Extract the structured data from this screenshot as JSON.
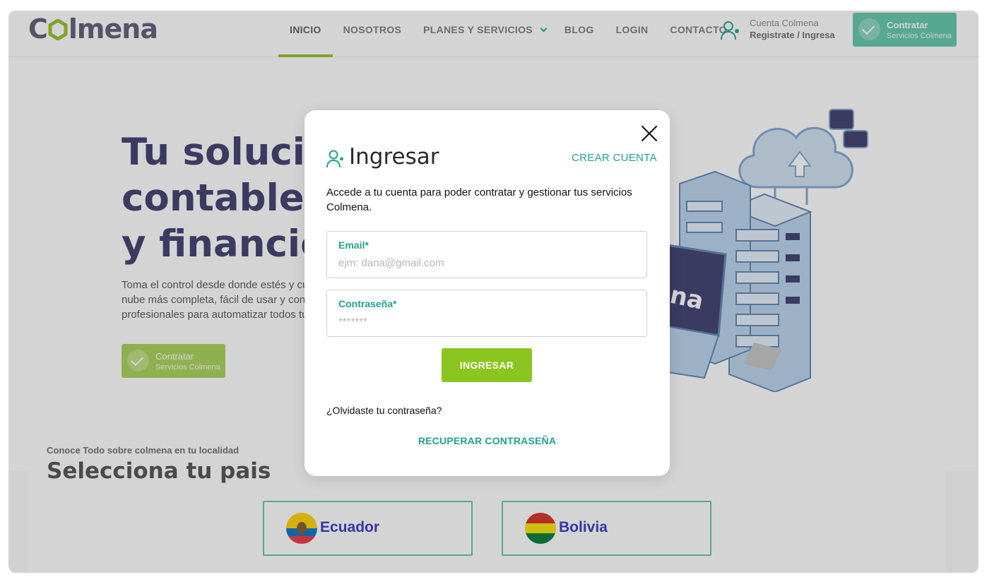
{
  "header": {
    "logo": {
      "pre": "C",
      "post": "lmena"
    },
    "nav": [
      {
        "label": "INICIO",
        "active": true
      },
      {
        "label": "NOSOTROS"
      },
      {
        "label": "PLANES Y SERVICIOS",
        "dropdown": true
      },
      {
        "label": "BLOG"
      },
      {
        "label": "LOGIN"
      },
      {
        "label": "CONTACTO"
      }
    ],
    "account": {
      "line1": "Cuenta Colmena",
      "line2": "Registrate / Ingresa",
      "icon": "user-icon"
    },
    "cta": {
      "line1": "Contratar",
      "line2": "Servicios Colmena",
      "icon": "check-circle-icon"
    }
  },
  "hero": {
    "title_lines": [
      "Tu solución",
      "contable, c",
      "y financier"
    ],
    "desc_lines": [
      "Toma el control desde donde estés y cu",
      "nube más completa, fácil de usar y con",
      "profesionales para automatizar todos tu"
    ],
    "cta": {
      "line1": "Contratar",
      "line2": "Servicios Colmena"
    },
    "illustration_text": "na"
  },
  "countries": {
    "kicker": "Conoce Todo sobre colmena en tu localidad",
    "heading": "Selecciona tu pais",
    "items": [
      {
        "name": "Ecuador",
        "flag": "ecuador-flag-icon"
      },
      {
        "name": "Bolivia",
        "flag": "bolivia-flag-icon"
      }
    ]
  },
  "modal": {
    "title": "Ingresar",
    "create_account": "CREAR CUENTA",
    "description": "Accede a tu cuenta para poder contratar y gestionar tus servicios Colmena.",
    "email": {
      "label": "Email*",
      "placeholder": "ejm: dana@gmail.com",
      "value": ""
    },
    "password": {
      "label": "Contraseña*",
      "placeholder": "*******",
      "value": ""
    },
    "submit": "INGRESAR",
    "forgot": "¿Olvidaste tu contraseña?",
    "recover": "RECUPERAR CONTRASEÑA"
  },
  "colors": {
    "brand_green": "#8bc51f",
    "teal": "#1fa38e",
    "navy": "#3b3b6d"
  }
}
